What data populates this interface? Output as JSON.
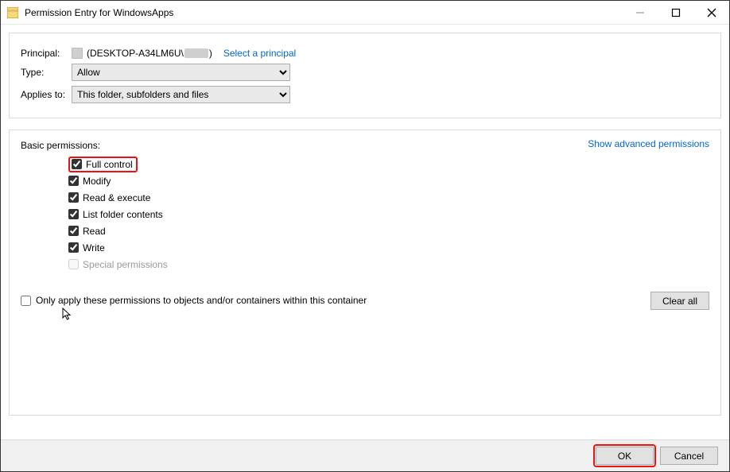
{
  "window": {
    "title": "Permission Entry for WindowsApps"
  },
  "principal": {
    "label": "Principal:",
    "value_prefix": "(DESKTOP-A34LM6U\\",
    "value_suffix": ")",
    "select_link": "Select a principal"
  },
  "type": {
    "label": "Type:",
    "value": "Allow"
  },
  "applies": {
    "label": "Applies to:",
    "value": "This folder, subfolders and files"
  },
  "permissions": {
    "header": "Basic permissions:",
    "advanced_link": "Show advanced permissions",
    "items": [
      {
        "label": "Full control",
        "checked": true,
        "highlight": true
      },
      {
        "label": "Modify",
        "checked": true
      },
      {
        "label": "Read & execute",
        "checked": true
      },
      {
        "label": "List folder contents",
        "checked": true
      },
      {
        "label": "Read",
        "checked": true
      },
      {
        "label": "Write",
        "checked": true
      },
      {
        "label": "Special permissions",
        "checked": false,
        "disabled": true
      }
    ],
    "only_apply": "Only apply these permissions to objects and/or containers within this container",
    "clear_all": "Clear all"
  },
  "footer": {
    "ok": "OK",
    "cancel": "Cancel"
  }
}
